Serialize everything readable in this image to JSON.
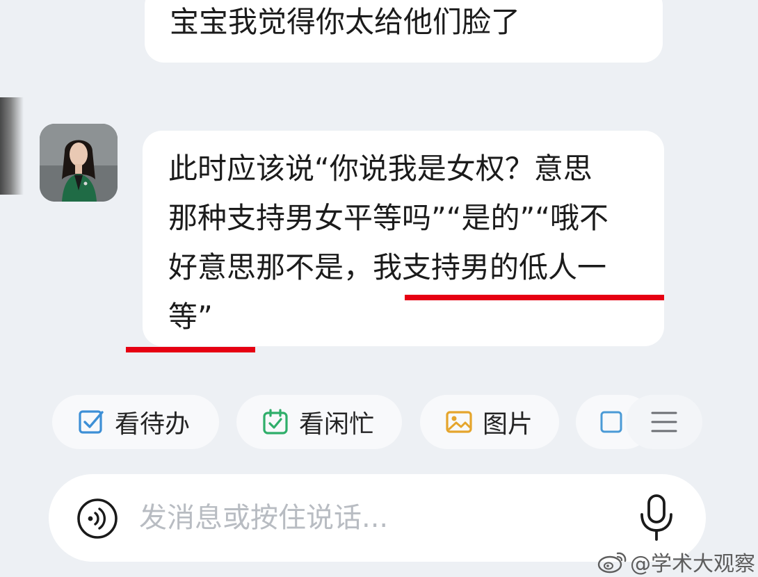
{
  "messages": {
    "prev_user": "宝宝我觉得你太给他们脸了",
    "reply": {
      "lines": [
        "此时应该说“你说我是女权？意思",
        "那种支持男女平等吗”“是的”“哦不",
        "好意思那不是，我支持男的低人一",
        "等”"
      ]
    }
  },
  "quick_actions": [
    {
      "label": "看待办",
      "icon": "todo-checkbox-icon"
    },
    {
      "label": "看闲忙",
      "icon": "calendar-check-icon"
    },
    {
      "label": "图片",
      "icon": "image-icon"
    }
  ],
  "input": {
    "placeholder": "发消息或按住说话..."
  },
  "watermark": {
    "text": "@学术大观察"
  },
  "colors": {
    "underline": "#e60012",
    "background": "#edf0f4",
    "todo_icon": "#3d8fd6",
    "calendar_icon": "#2fae6a",
    "image_icon": "#e5a52c"
  }
}
